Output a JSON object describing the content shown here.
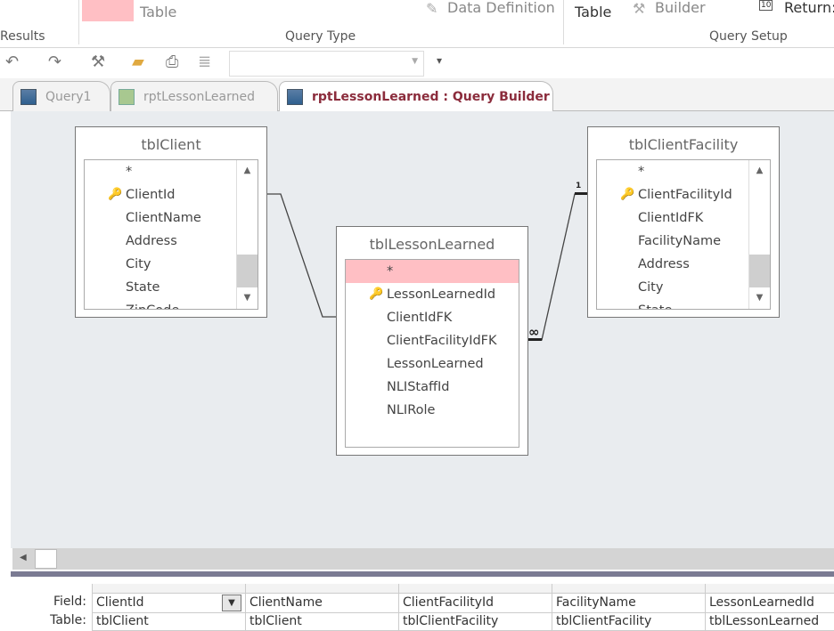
{
  "ribbon": {
    "groups": [
      "Results",
      "Query Type",
      "Query Setup"
    ],
    "make_table_label": "Table",
    "data_definition": "Data Definition",
    "show_table": "Table",
    "builder": "Builder",
    "return": "Return:",
    "return_icon_text": "10"
  },
  "quick_access": {
    "undo": "undo-icon",
    "redo": "redo-icon",
    "customize": "▾",
    "combo_value": ""
  },
  "tabs": [
    {
      "label": "Query1"
    },
    {
      "label": "rptLessonLearned"
    },
    {
      "label": "rptLessonLearned : Query Builder"
    }
  ],
  "tables": {
    "client": {
      "title": "tblClient",
      "fields": [
        "*",
        "ClientId",
        "ClientName",
        "Address",
        "City",
        "State",
        "ZipCode"
      ]
    },
    "lesson": {
      "title": "tblLessonLearned",
      "fields": [
        "*",
        "LessonLearnedId",
        "ClientIdFK",
        "ClientFacilityIdFK",
        "LessonLearned",
        "NLIStaffId",
        "NLIRole"
      ]
    },
    "facility": {
      "title": "tblClientFacility",
      "fields": [
        "*",
        "ClientFacilityId",
        "ClientIdFK",
        "FacilityName",
        "Address",
        "City",
        "State"
      ]
    }
  },
  "relationship": {
    "one": "1",
    "many": "∞"
  },
  "grid": {
    "row_labels": [
      "Field:",
      "Table:"
    ],
    "columns": [
      {
        "field": "ClientId",
        "table": "tblClient"
      },
      {
        "field": "ClientName",
        "table": "tblClient"
      },
      {
        "field": "ClientFacilityId",
        "table": "tblClientFacility"
      },
      {
        "field": "FacilityName",
        "table": "tblClientFacility"
      },
      {
        "field": "LessonLearnedId",
        "table": "tblLessonLearned"
      }
    ]
  }
}
